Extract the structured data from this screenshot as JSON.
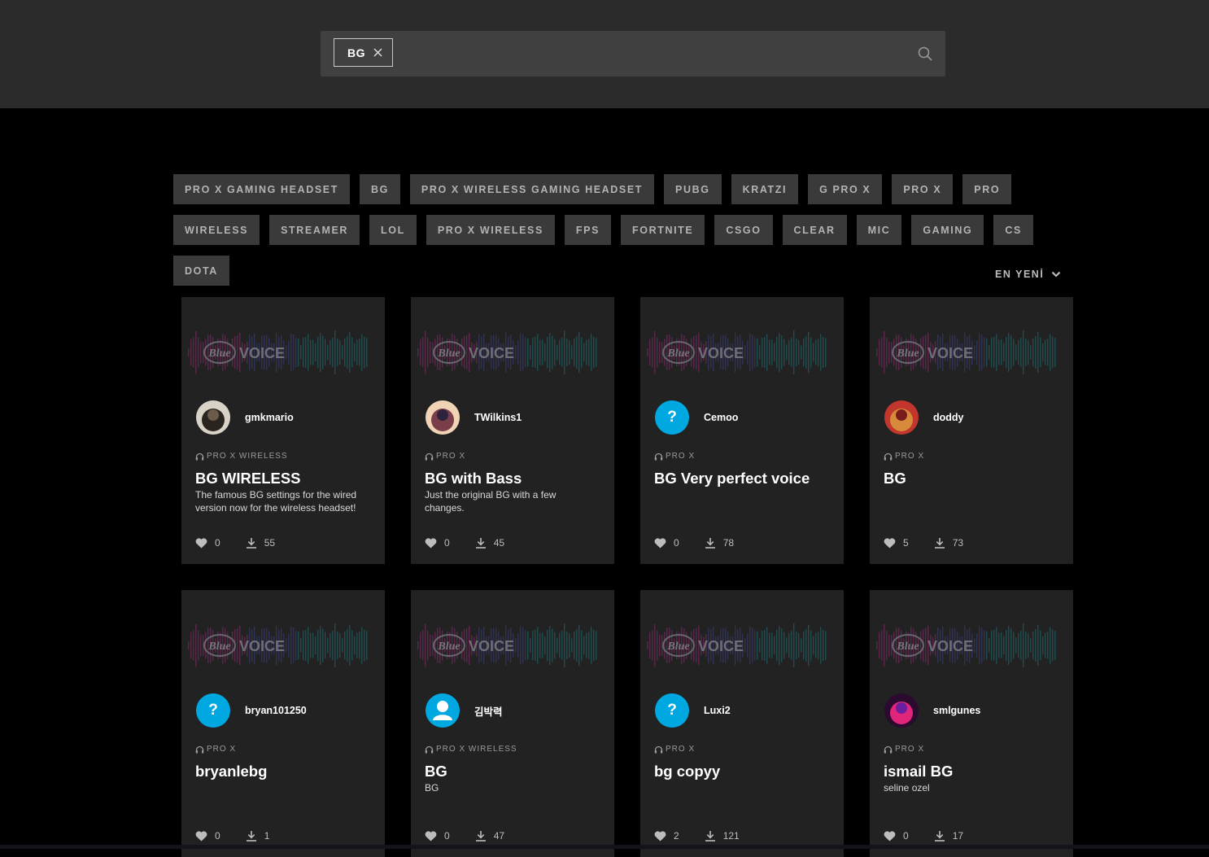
{
  "search": {
    "chip_label": "BG"
  },
  "tags": [
    "PRO X GAMING HEADSET",
    "BG",
    "PRO X WIRELESS GAMING HEADSET",
    "PUBG",
    "KRATZI",
    "G PRO X",
    "PRO X",
    "PRO",
    "WIRELESS",
    "STREAMER",
    "LOL",
    "PRO X WIRELESS",
    "FPS",
    "FORTNITE",
    "CSGO",
    "CLEAR",
    "MIC",
    "GAMING",
    "CS",
    "DOTA"
  ],
  "sort_label": "EN YENİ",
  "banner_logo": "Blue",
  "banner_text": "VOICE",
  "colors": {
    "accent_blue": "#00a8e1",
    "card_bg": "#222222",
    "tag_bg": "#3a3a3a",
    "topbar_bg": "#2b2b2b"
  },
  "cards": [
    {
      "user": "gmkmario",
      "avatar": "photo-dark",
      "device": "PRO X WIRELESS",
      "title": "BG WIRELESS",
      "desc": "The famous BG settings for the wired version now for the wireless headset!",
      "likes": "0",
      "downloads": "55"
    },
    {
      "user": "TWilkins1",
      "avatar": "photo-art",
      "device": "PRO X",
      "title": "BG with Bass",
      "desc": "Just the original BG with a few changes.",
      "likes": "0",
      "downloads": "45"
    },
    {
      "user": "Cemoo",
      "avatar": "question",
      "device": "PRO X",
      "title": "BG Very perfect voice",
      "desc": "",
      "likes": "0",
      "downloads": "78"
    },
    {
      "user": "doddy",
      "avatar": "photo-red",
      "device": "PRO X",
      "title": "BG",
      "desc": "",
      "likes": "5",
      "downloads": "73"
    },
    {
      "user": "bryan101250",
      "avatar": "question",
      "device": "PRO X",
      "title": "bryanlebg",
      "desc": "",
      "likes": "0",
      "downloads": "1"
    },
    {
      "user": "김박력",
      "avatar": "person",
      "device": "PRO X WIRELESS",
      "title": "BG",
      "desc": "BG",
      "likes": "0",
      "downloads": "47"
    },
    {
      "user": "Luxi2",
      "avatar": "question",
      "device": "PRO X",
      "title": "bg copyy",
      "desc": "",
      "likes": "2",
      "downloads": "121"
    },
    {
      "user": "smlgunes",
      "avatar": "photo-neon",
      "device": "PRO X",
      "title": "ismail BG",
      "desc": "seline ozel",
      "likes": "0",
      "downloads": "17"
    }
  ]
}
